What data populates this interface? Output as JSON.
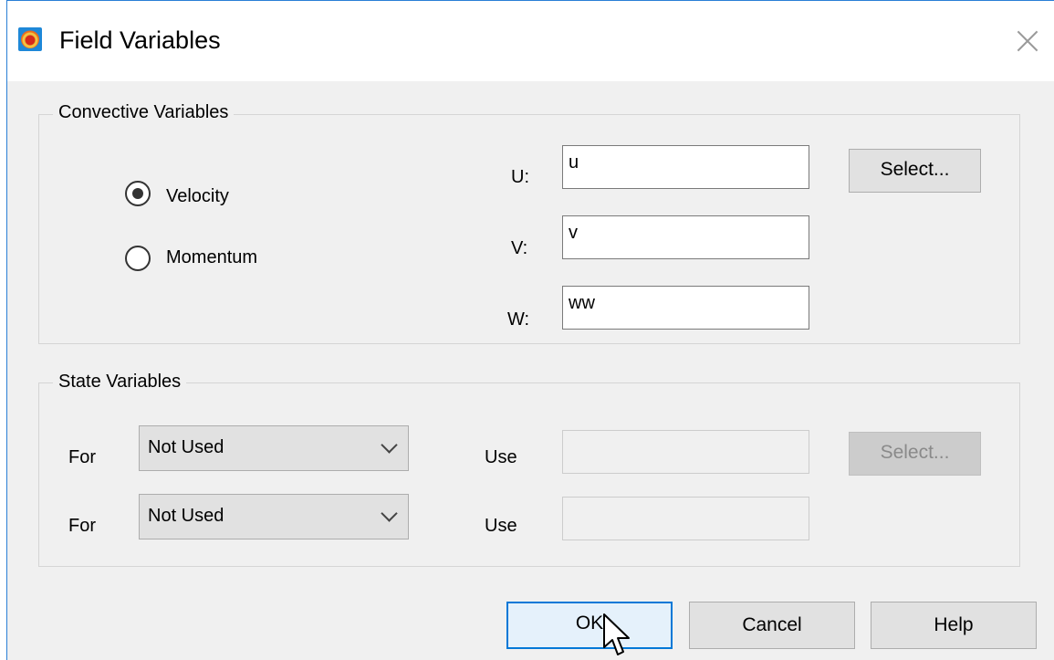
{
  "window": {
    "title": "Field Variables",
    "app_icon": "tecplot-app-icon",
    "close_icon": "close-icon"
  },
  "convective": {
    "legend": "Convective Variables",
    "radios": [
      {
        "label": "Velocity",
        "checked": true
      },
      {
        "label": "Momentum",
        "checked": false
      }
    ],
    "fields": [
      {
        "label": "U:",
        "value": "u"
      },
      {
        "label": "V:",
        "value": "v"
      },
      {
        "label": "W:",
        "value": "ww"
      }
    ],
    "select_label": "Select..."
  },
  "state": {
    "legend": "State Variables",
    "rows": [
      {
        "for_label": "For",
        "combo_value": "Not Used",
        "use_label": "Use",
        "use_value": ""
      },
      {
        "for_label": "For",
        "combo_value": "Not Used",
        "use_label": "Use",
        "use_value": ""
      }
    ],
    "select_label": "Select..."
  },
  "buttons": {
    "ok": "OK",
    "cancel": "Cancel",
    "help": "Help"
  },
  "colors": {
    "accent": "#0078d7",
    "button_bg": "#e1e1e1",
    "window_bg": "#f0f0f0"
  }
}
